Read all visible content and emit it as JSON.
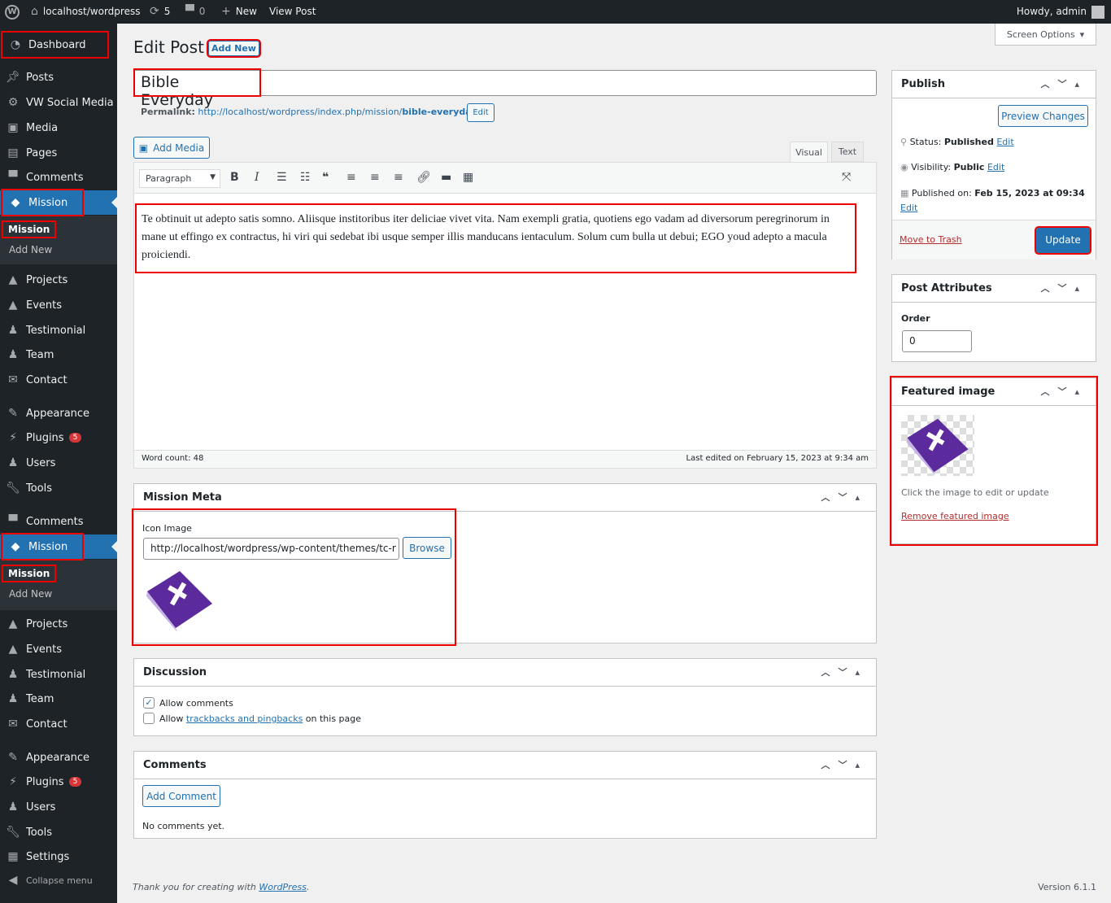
{
  "adminbar": {
    "site": "localhost/wordpress",
    "updates": "5",
    "comments": "0",
    "new": "New",
    "view": "View Post",
    "howdy": "Howdy, admin"
  },
  "sidebar": {
    "items": [
      {
        "label": "Dashboard",
        "icon": "dashboard-icon"
      },
      {
        "label": "Posts",
        "icon": "pin-icon"
      },
      {
        "label": "VW Social Media",
        "icon": "gear-icon"
      },
      {
        "label": "Media",
        "icon": "media-icon"
      },
      {
        "label": "Pages",
        "icon": "pages-icon"
      },
      {
        "label": "Comments",
        "icon": "comment-icon"
      },
      {
        "label": "Mission",
        "icon": "tag-icon"
      },
      {
        "label": "Projects",
        "icon": "cap-icon"
      },
      {
        "label": "Events",
        "icon": "cap-icon"
      },
      {
        "label": "Testimonial",
        "icon": "users-icon"
      },
      {
        "label": "Team",
        "icon": "users-icon"
      },
      {
        "label": "Contact",
        "icon": "mail-icon"
      },
      {
        "label": "Appearance",
        "icon": "brush-icon"
      },
      {
        "label": "Plugins",
        "icon": "plug-icon"
      },
      {
        "label": "Users",
        "icon": "user-icon"
      },
      {
        "label": "Tools",
        "icon": "wrench-icon"
      },
      {
        "label": "Comments",
        "icon": "comment-icon"
      },
      {
        "label": "Mission",
        "icon": "tag-icon"
      },
      {
        "label": "Projects",
        "icon": "cap-icon"
      },
      {
        "label": "Events",
        "icon": "cap-icon"
      },
      {
        "label": "Testimonial",
        "icon": "users-icon"
      },
      {
        "label": "Team",
        "icon": "users-icon"
      },
      {
        "label": "Contact",
        "icon": "mail-icon"
      },
      {
        "label": "Appearance",
        "icon": "brush-icon"
      },
      {
        "label": "Plugins",
        "icon": "plug-icon"
      },
      {
        "label": "Users",
        "icon": "user-icon"
      },
      {
        "label": "Tools",
        "icon": "wrench-icon"
      },
      {
        "label": "Settings",
        "icon": "settings-icon"
      }
    ],
    "plugins_badge": "5",
    "sub_mission": "Mission",
    "sub_add_new": "Add New",
    "collapse": "Collapse menu"
  },
  "header": {
    "title": "Edit Post",
    "add_new": "Add New",
    "screen_options": "Screen Options"
  },
  "post": {
    "title": "Bible Everyday",
    "permalink_label": "Permalink:",
    "permalink_base": "http://localhost/wordpress/index.php/mission/",
    "permalink_slug": "bible-everyday/",
    "edit": "Edit"
  },
  "editor": {
    "add_media": "Add Media",
    "tab_visual": "Visual",
    "tab_text": "Text",
    "format": "Paragraph",
    "content": "Te obtinuit ut adepto satis somno. Aliisque institoribus iter deliciae vivet vita. Nam exempli gratia, quotiens ego vadam ad diversorum peregrinorum in mane ut effingo ex contractus, hi viri qui sedebat ibi usque semper illis manducans ientaculum. Solum cum bulla ut debui; EGO youd adepto a macula proiciendi.",
    "word_count": "Word count: 48",
    "last_edited": "Last edited on February 15, 2023 at 9:34 am"
  },
  "mission_meta": {
    "title": "Mission Meta",
    "label": "Icon Image",
    "value": "http://localhost/wordpress/wp-content/themes/tc-r",
    "browse": "Browse"
  },
  "discussion": {
    "title": "Discussion",
    "allow_comments": "Allow comments",
    "allow_pre": "Allow ",
    "allow_link": "trackbacks and pingbacks",
    "allow_post": " on this page",
    "comments_checked": true,
    "pings_checked": false
  },
  "comments": {
    "title": "Comments",
    "add": "Add Comment",
    "none": "No comments yet."
  },
  "publish": {
    "title": "Publish",
    "preview": "Preview Changes",
    "status_label": "Status:",
    "status": "Published",
    "visibility_label": "Visibility:",
    "visibility": "Public",
    "published_label": "Published on:",
    "published": "Feb 15, 2023 at 09:34",
    "edit": "Edit",
    "trash": "Move to Trash",
    "update": "Update"
  },
  "attributes": {
    "title": "Post Attributes",
    "order_label": "Order",
    "order": "0"
  },
  "featured": {
    "title": "Featured image",
    "hint": "Click the image to edit or update",
    "remove": "Remove featured image"
  },
  "footer": {
    "thanks": "Thank you for creating with ",
    "wp": "WordPress",
    "dot": ".",
    "version": "Version 6.1.1"
  },
  "colors": {
    "accent": "#2271b1",
    "sidebar": "#1d2327",
    "book": "#5b2a9c"
  }
}
